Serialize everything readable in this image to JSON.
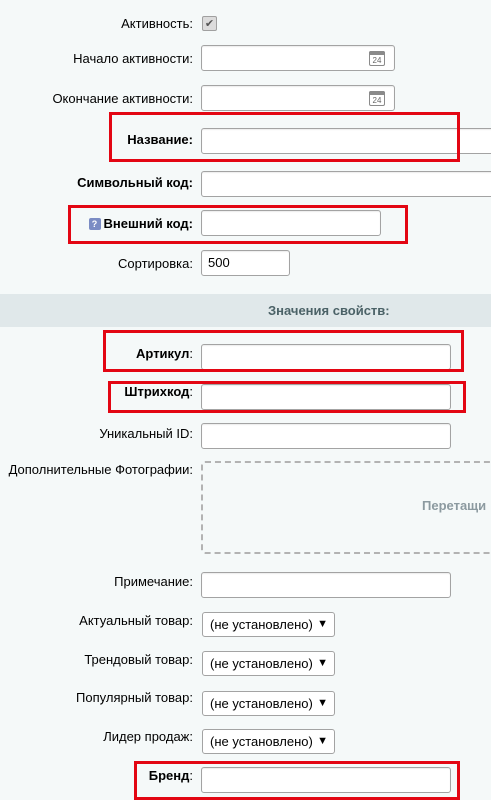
{
  "form": {
    "active": {
      "label": "Активность:",
      "checked": true
    },
    "active_from": {
      "label": "Начало активности:",
      "value": "",
      "calendar_day": "24"
    },
    "active_to": {
      "label": "Окончание активности:",
      "value": "",
      "calendar_day": "24"
    },
    "name": {
      "label": "Название:",
      "value": ""
    },
    "code": {
      "label": "Символьный код:",
      "value": ""
    },
    "external_code": {
      "label": "Внешний код:",
      "value": "",
      "help_icon": "?"
    },
    "sort": {
      "label": "Сортировка:",
      "value": "500"
    }
  },
  "properties": {
    "title": "Значения свойств:",
    "article": {
      "label": "Артикул",
      "colon": ":",
      "value": ""
    },
    "barcode": {
      "label": "Штрихкод",
      "colon": ":",
      "value": ""
    },
    "unique_id": {
      "label": "Уникальный ID:",
      "value": ""
    },
    "photos": {
      "label": "Дополнительные Фотографии:",
      "dropzone_text": "Перетащи"
    },
    "note": {
      "label": "Примечание:",
      "value": ""
    },
    "actual": {
      "label": "Актуальный товар:",
      "selected": "(не установлено)"
    },
    "trend": {
      "label": "Трендовый товар:",
      "selected": "(не установлено)"
    },
    "popular": {
      "label": "Популярный товар:",
      "selected": "(не установлено)"
    },
    "leader": {
      "label": "Лидер продаж:",
      "selected": "(не установлено)"
    },
    "brand": {
      "label": "Бренд",
      "colon": ":",
      "value": ""
    }
  },
  "highlight_color": "#e30613"
}
